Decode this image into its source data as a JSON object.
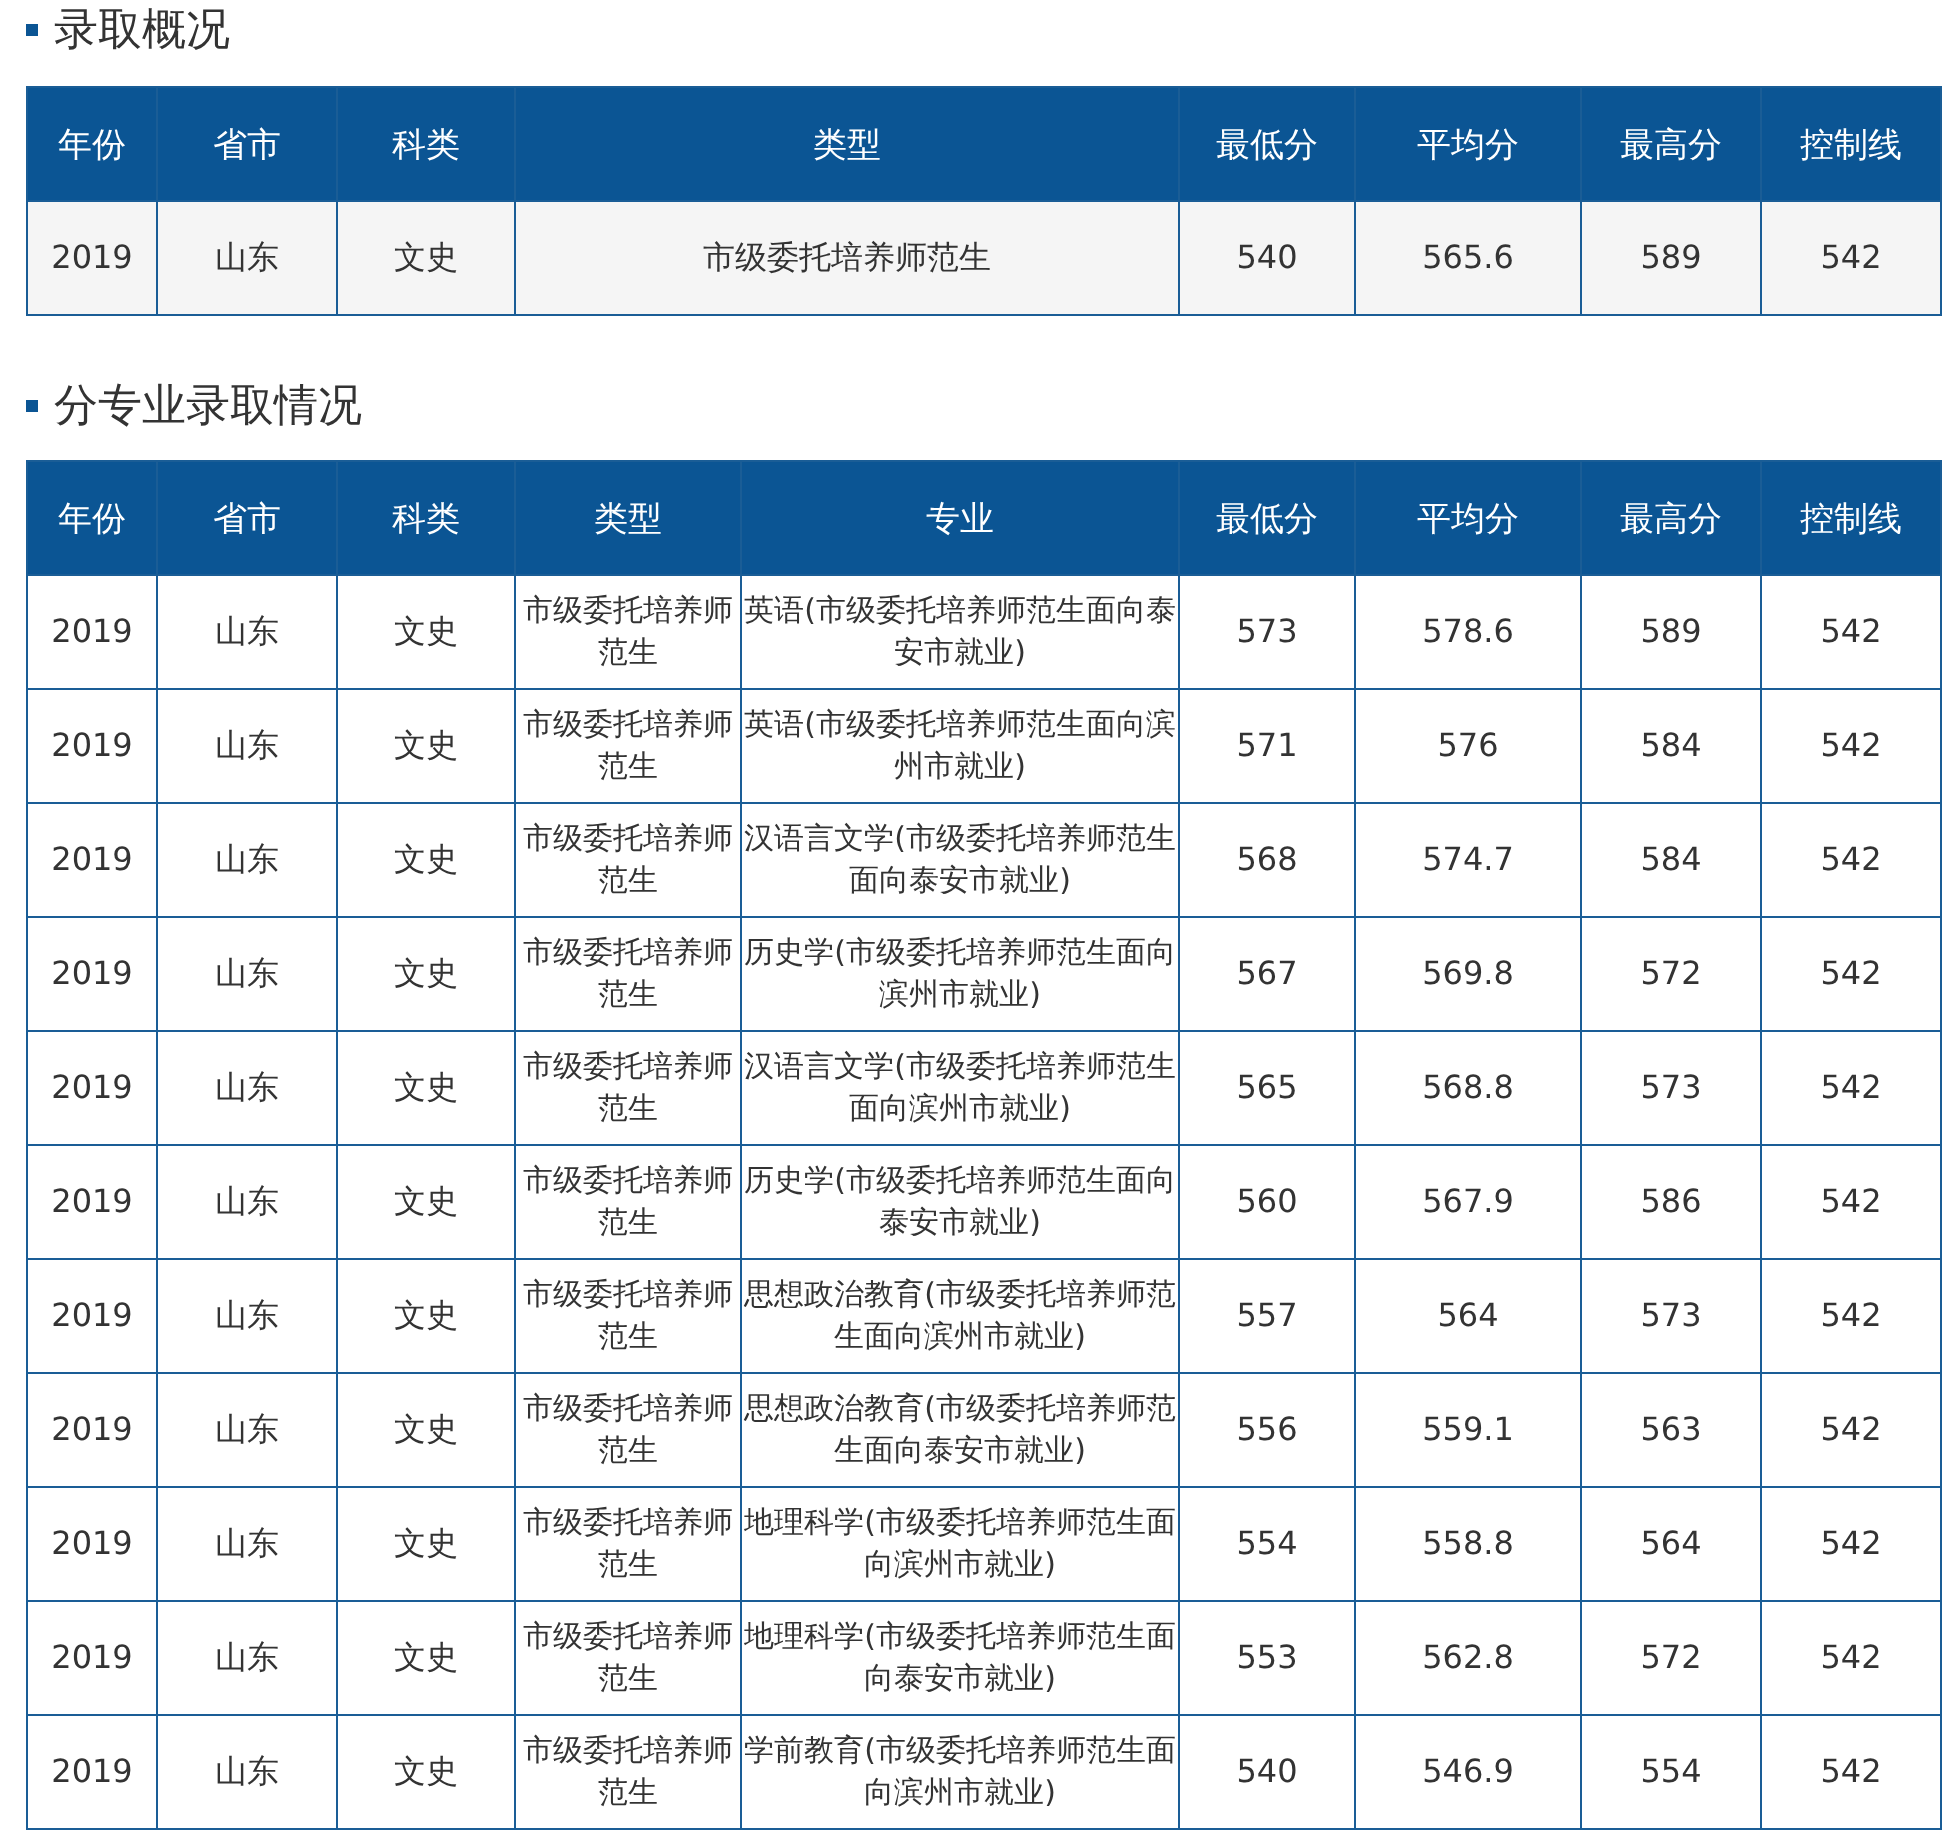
{
  "sections": [
    {
      "title": "录取概况",
      "table": {
        "columns": [
          "年份",
          "省市",
          "科类",
          "类型",
          "最低分",
          "平均分",
          "最高分",
          "控制线"
        ],
        "rows": [
          [
            "2019",
            "山东",
            "文史",
            "市级委托培养师范生",
            "540",
            "565.6",
            "589",
            "542"
          ]
        ]
      }
    },
    {
      "title": "分专业录取情况",
      "table": {
        "columns": [
          "年份",
          "省市",
          "科类",
          "类型",
          "专业",
          "最低分",
          "平均分",
          "最高分",
          "控制线"
        ],
        "rows": [
          [
            "2019",
            "山东",
            "文史",
            "市级委托培养师范生",
            "英语(市级委托培养师范生面向泰安市就业)",
            "573",
            "578.6",
            "589",
            "542"
          ],
          [
            "2019",
            "山东",
            "文史",
            "市级委托培养师范生",
            "英语(市级委托培养师范生面向滨州市就业)",
            "571",
            "576",
            "584",
            "542"
          ],
          [
            "2019",
            "山东",
            "文史",
            "市级委托培养师范生",
            "汉语言文学(市级委托培养师范生面向泰安市就业)",
            "568",
            "574.7",
            "584",
            "542"
          ],
          [
            "2019",
            "山东",
            "文史",
            "市级委托培养师范生",
            "历史学(市级委托培养师范生面向滨州市就业)",
            "567",
            "569.8",
            "572",
            "542"
          ],
          [
            "2019",
            "山东",
            "文史",
            "市级委托培养师范生",
            "汉语言文学(市级委托培养师范生面向滨州市就业)",
            "565",
            "568.8",
            "573",
            "542"
          ],
          [
            "2019",
            "山东",
            "文史",
            "市级委托培养师范生",
            "历史学(市级委托培养师范生面向泰安市就业)",
            "560",
            "567.9",
            "586",
            "542"
          ],
          [
            "2019",
            "山东",
            "文史",
            "市级委托培养师范生",
            "思想政治教育(市级委托培养师范生面向滨州市就业)",
            "557",
            "564",
            "573",
            "542"
          ],
          [
            "2019",
            "山东",
            "文史",
            "市级委托培养师范生",
            "思想政治教育(市级委托培养师范生面向泰安市就业)",
            "556",
            "559.1",
            "563",
            "542"
          ],
          [
            "2019",
            "山东",
            "文史",
            "市级委托培养师范生",
            "地理科学(市级委托培养师范生面向滨州市就业)",
            "554",
            "558.8",
            "564",
            "542"
          ],
          [
            "2019",
            "山东",
            "文史",
            "市级委托培养师范生",
            "地理科学(市级委托培养师范生面向泰安市就业)",
            "553",
            "562.8",
            "572",
            "542"
          ],
          [
            "2019",
            "山东",
            "文史",
            "市级委托培养师范生",
            "学前教育(市级委托培养师范生面向滨州市就业)",
            "540",
            "546.9",
            "554",
            "542"
          ]
        ]
      }
    }
  ]
}
